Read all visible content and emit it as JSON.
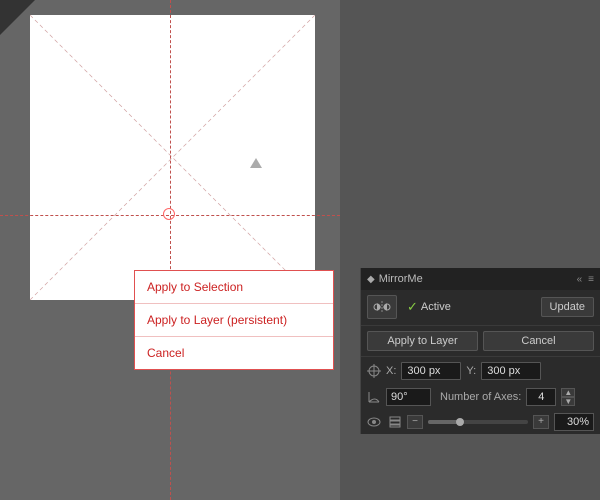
{
  "canvas": {
    "background": "#666",
    "square_bg": "#fff"
  },
  "context_menu": {
    "items": [
      {
        "label": "Apply to Selection",
        "id": "apply-selection"
      },
      {
        "label": "Apply to Layer (persistent)",
        "id": "apply-layer-persistent"
      },
      {
        "label": "Cancel",
        "id": "cancel"
      }
    ]
  },
  "panel": {
    "title": "MirrorMe",
    "title_icon": "◆",
    "controls": {
      "collapse": "«",
      "menu": "≡",
      "close": "✕"
    },
    "active_label": "Active",
    "update_btn": "Update",
    "apply_layer_btn": "Apply to Layer",
    "cancel_btn": "Cancel",
    "x_label": "X:",
    "x_value": "300 px",
    "y_label": "Y:",
    "y_value": "300 px",
    "angle_label": "°",
    "angle_value": "90°",
    "axes_label": "Number of Axes:",
    "axes_value": "4",
    "opacity_value": "30%"
  }
}
